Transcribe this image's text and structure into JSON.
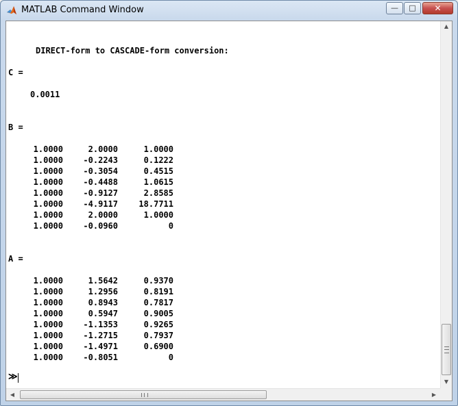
{
  "window": {
    "title": "MATLAB Command Window",
    "minimize_glyph": "—",
    "maximize_glyph": "□",
    "close_glyph": "✕"
  },
  "console": {
    "heading": "DIRECT-form to CASCADE-form conversion:",
    "c_label": "C =",
    "c_value": "0.0011",
    "b_label": "B =",
    "b_rows": [
      [
        "1.0000",
        "2.0000",
        "1.0000"
      ],
      [
        "1.0000",
        "-0.2243",
        "0.1222"
      ],
      [
        "1.0000",
        "-0.3054",
        "0.4515"
      ],
      [
        "1.0000",
        "-0.4488",
        "1.0615"
      ],
      [
        "1.0000",
        "-0.9127",
        "2.8585"
      ],
      [
        "1.0000",
        "-4.9117",
        "18.7711"
      ],
      [
        "1.0000",
        "2.0000",
        "1.0000"
      ],
      [
        "1.0000",
        "-0.0960",
        "0"
      ]
    ],
    "a_label": "A =",
    "a_rows": [
      [
        "1.0000",
        "1.5642",
        "0.9370"
      ],
      [
        "1.0000",
        "1.2956",
        "0.8191"
      ],
      [
        "1.0000",
        "0.8943",
        "0.7817"
      ],
      [
        "1.0000",
        "0.5947",
        "0.9005"
      ],
      [
        "1.0000",
        "-1.1353",
        "0.9265"
      ],
      [
        "1.0000",
        "-1.2715",
        "0.7937"
      ],
      [
        "1.0000",
        "-1.4971",
        "0.6900"
      ],
      [
        "1.0000",
        "-0.8051",
        "0"
      ]
    ],
    "prompt": "≫"
  },
  "scrollbars": {
    "up_arrow": "▲",
    "down_arrow": "▼",
    "left_arrow": "◀",
    "right_arrow": "▶"
  }
}
